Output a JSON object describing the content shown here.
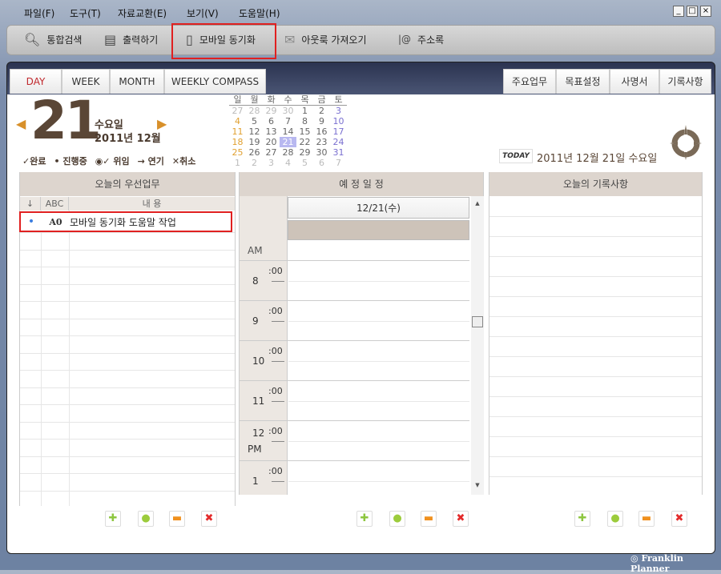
{
  "menu": [
    "파일(F)",
    "도구(T)",
    "자료교환(E)",
    "보기(V)",
    "도움말(H)"
  ],
  "window_controls": [
    "_",
    "□",
    "×"
  ],
  "toolbar": [
    {
      "label": "통합검색",
      "icon": "search-icon"
    },
    {
      "label": "출력하기",
      "icon": "printer-icon"
    },
    {
      "label": "모바일 동기화",
      "icon": "mobile-phone-icon",
      "highlighted": true
    },
    {
      "label": "아웃룩 가져오기",
      "icon": "outlook-icon"
    },
    {
      "label": "주소록",
      "icon": "address-book-icon"
    }
  ],
  "view_tabs": [
    "DAY",
    "WEEK",
    "MONTH",
    "WEEKLY COMPASS"
  ],
  "active_tab": "DAY",
  "right_tabs": [
    "주요업무",
    "목표설정",
    "사명서",
    "기록사항"
  ],
  "date": {
    "day": "21",
    "weekday": "수요일",
    "year_month": "2011년 12월"
  },
  "legend": [
    "✓완료",
    "• 진행중",
    "◉✓ 위임",
    "→ 연기",
    "✕취소"
  ],
  "mini_calendar": {
    "headers": [
      "일",
      "월",
      "화",
      "수",
      "목",
      "금",
      "토"
    ],
    "weeks": [
      [
        "27",
        "28",
        "29",
        "30",
        "1",
        "2",
        "3"
      ],
      [
        "4",
        "5",
        "6",
        "7",
        "8",
        "9",
        "10"
      ],
      [
        "11",
        "12",
        "13",
        "14",
        "15",
        "16",
        "17"
      ],
      [
        "18",
        "19",
        "20",
        "21",
        "22",
        "23",
        "24"
      ],
      [
        "25",
        "26",
        "27",
        "28",
        "29",
        "30",
        "31"
      ],
      [
        "1",
        "2",
        "3",
        "4",
        "5",
        "6",
        "7"
      ]
    ],
    "selected": "21"
  },
  "today": {
    "badge": "TODAY",
    "text": "2011년 12월 21일 수요일"
  },
  "priority": {
    "title": "오늘의 우선업무",
    "columns": [
      "↓",
      "ABC",
      "내 용"
    ],
    "rows": [
      {
        "status": "•",
        "abc": "A0",
        "content": "모바일 동기화 도움말 작업"
      }
    ]
  },
  "schedule": {
    "title": "예 정 일 정",
    "date": "12/21(수)",
    "am": "AM",
    "hours": [
      {
        "h": "8",
        "m": ":00"
      },
      {
        "h": "9",
        "m": ":00"
      },
      {
        "h": "10",
        "m": ":00"
      },
      {
        "h": "11",
        "m": ":00"
      },
      {
        "h": "12",
        "m": ":00",
        "sub": "PM"
      },
      {
        "h": "1",
        "m": ":00"
      }
    ]
  },
  "notes": {
    "title": "오늘의 기록사항"
  },
  "action_buttons": [
    {
      "name": "add",
      "glyph": "✚",
      "color": "#8dc63f"
    },
    {
      "name": "edit",
      "glyph": "●",
      "color": "#9ccc3c"
    },
    {
      "name": "remove",
      "glyph": "▬",
      "color": "#f0901e"
    },
    {
      "name": "delete",
      "glyph": "✖",
      "color": "#e32b2b"
    }
  ],
  "footer": {
    "brand": "Franklin Planner"
  },
  "colors": {
    "accent_red": "#e02020",
    "date_brown": "#5a4636",
    "header_tan": "#ddd5ce"
  }
}
